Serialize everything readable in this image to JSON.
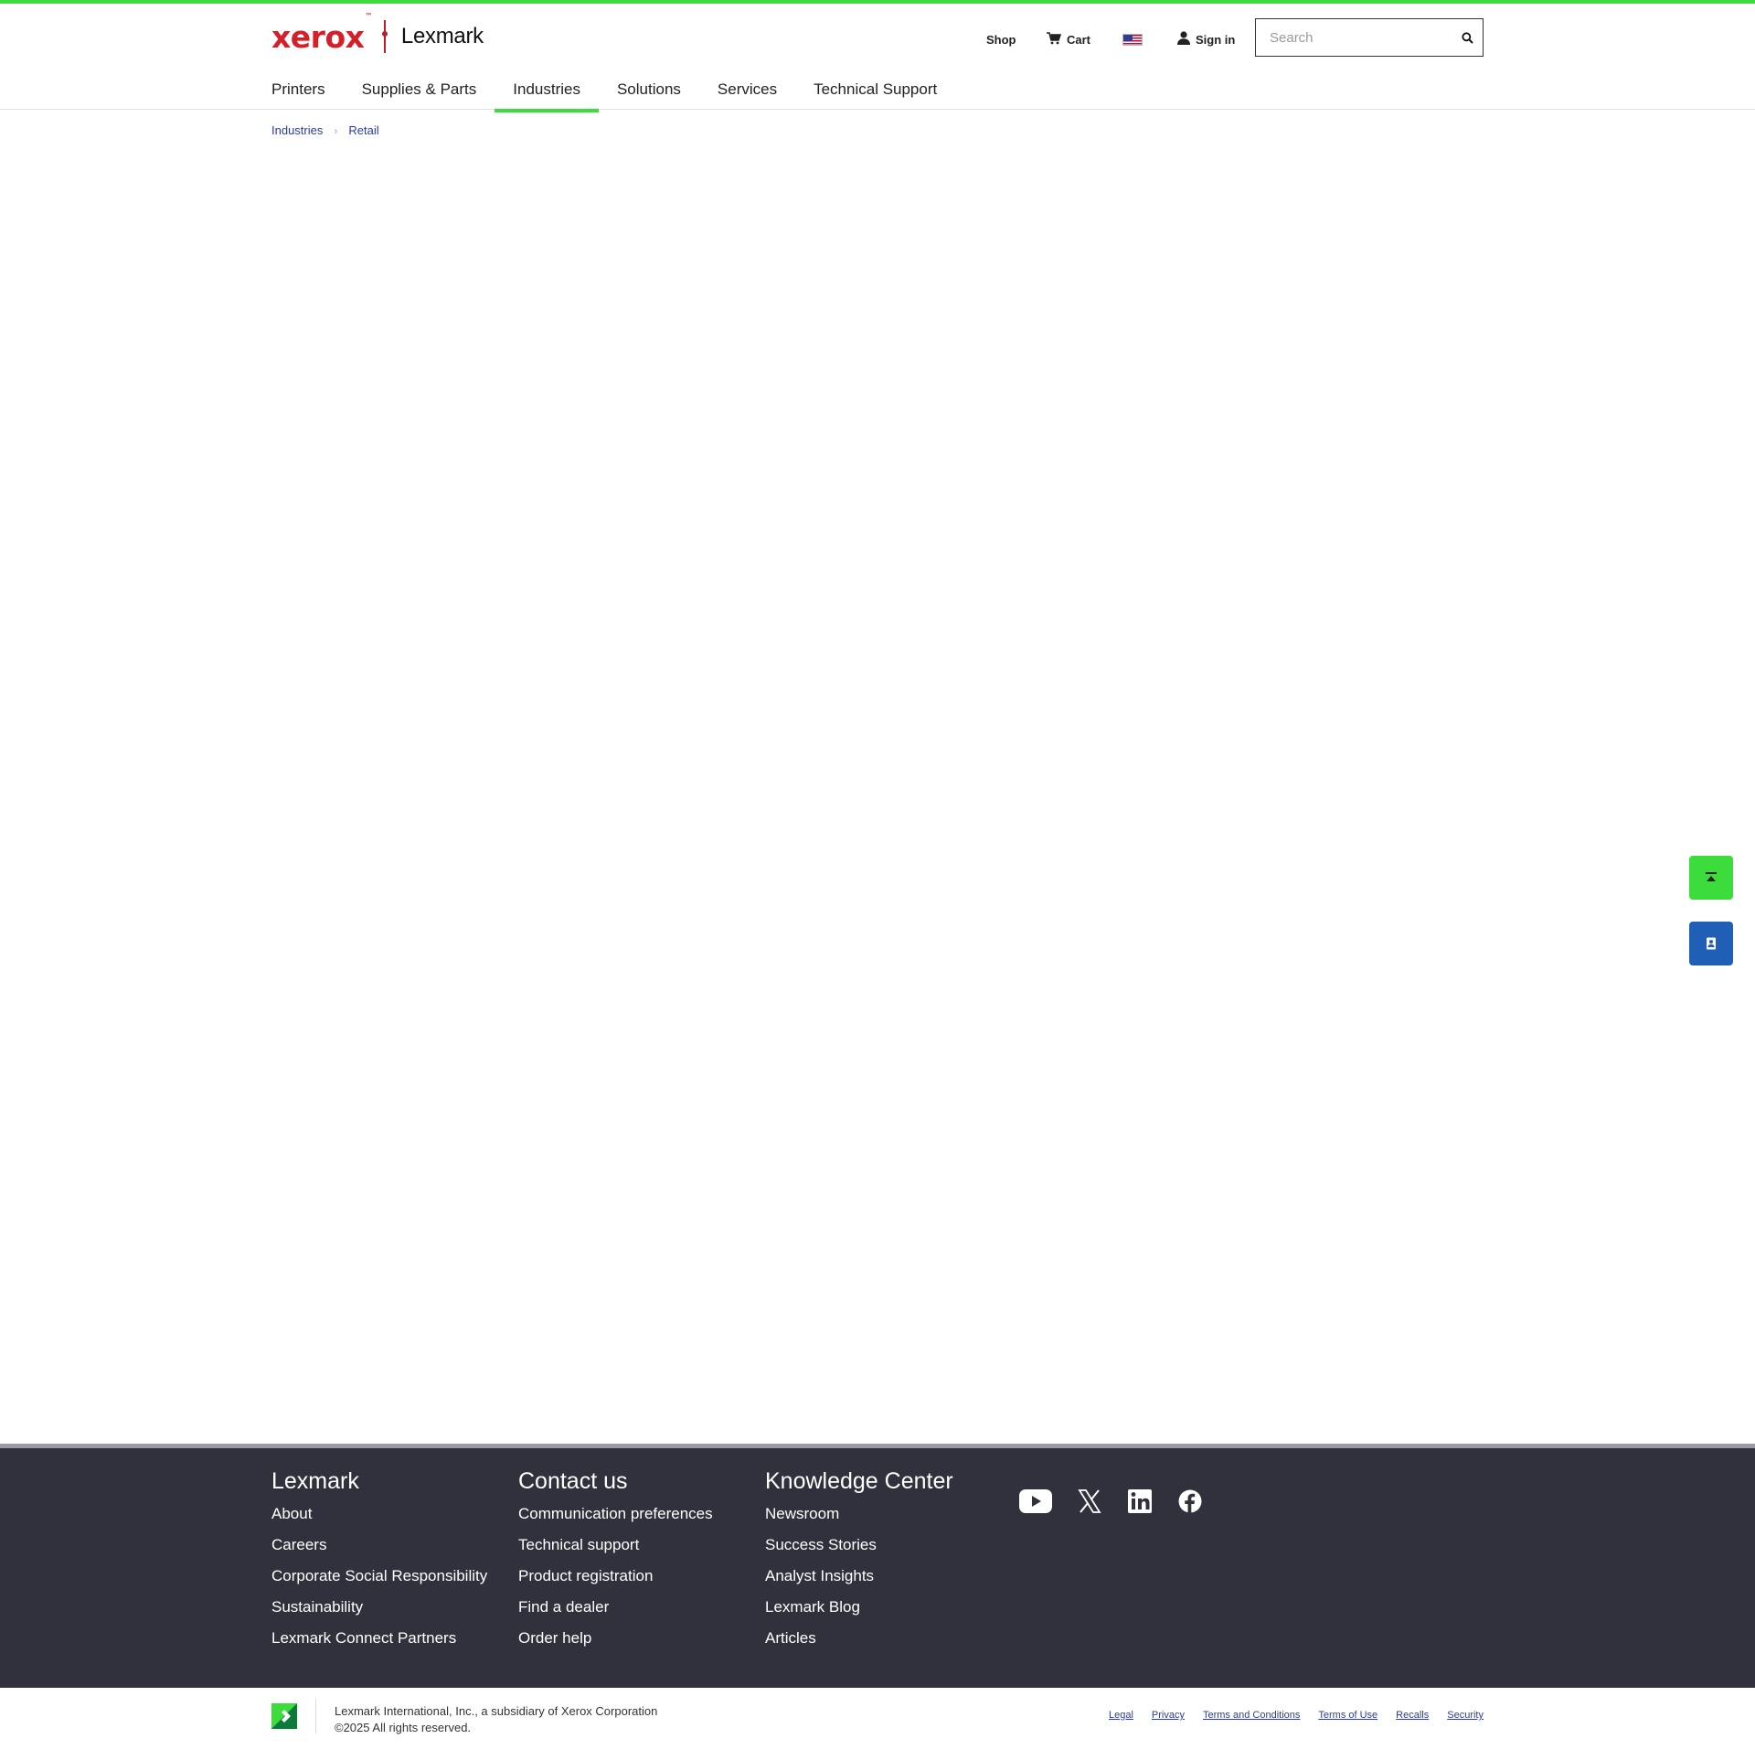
{
  "brand": {
    "xerox": "xerox",
    "tm": "™",
    "lexmark": "Lexmark"
  },
  "utility": {
    "shop": "Shop",
    "cart": "Cart",
    "sign_in": "Sign in"
  },
  "search": {
    "placeholder": "Search",
    "value": ""
  },
  "nav": {
    "items": [
      "Printers",
      "Supplies & Parts",
      "Industries",
      "Solutions",
      "Services",
      "Technical Support"
    ],
    "active": "Industries"
  },
  "breadcrumb": [
    "Industries",
    "Retail"
  ],
  "footer": {
    "columns": [
      {
        "title": "Lexmark",
        "links": [
          "About",
          "Careers",
          "Corporate Social Responsibility",
          "Sustainability",
          "Lexmark Connect Partners"
        ]
      },
      {
        "title": "Contact us",
        "links": [
          "Communication preferences",
          "Technical support",
          "Product registration",
          "Find a dealer",
          "Order help"
        ]
      },
      {
        "title": "Knowledge Center",
        "links": [
          "Newsroom",
          "Success Stories",
          "Analyst Insights",
          "Lexmark Blog",
          "Articles"
        ]
      }
    ],
    "socials": [
      "youtube-icon",
      "x-icon",
      "linkedin-icon",
      "facebook-icon"
    ]
  },
  "bottom": {
    "company": "Lexmark International, Inc., a subsidiary of Xerox Corporation",
    "copyright": "©2025 All rights reserved.",
    "links": [
      "Legal",
      "Privacy",
      "Terms and Conditions",
      "Terms of Use",
      "Recalls",
      "Security"
    ]
  },
  "colors": {
    "accent_green": "#3ddc3d",
    "xerox_red": "#d3202b",
    "link_blue": "#2b3d9c",
    "footer_bg": "#30313c",
    "contact_blue": "#1f5fb5"
  }
}
